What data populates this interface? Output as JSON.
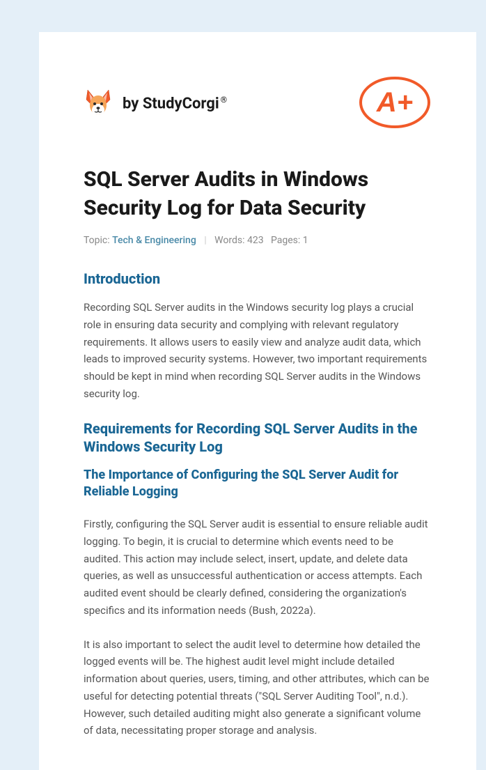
{
  "brand": {
    "prefix": "by ",
    "name": "StudyCorgi",
    "reg": "®"
  },
  "grade": "A+",
  "title": "SQL Server Audits in Windows Security Log for Data Security",
  "meta": {
    "topic_label": "Topic: ",
    "topic_value": "Tech & Engineering",
    "words_label": "Words: ",
    "words_value": "423",
    "pages_label": "Pages: ",
    "pages_value": "1"
  },
  "sections": {
    "intro_heading": "Introduction",
    "intro_p1": "Recording SQL Server audits in the Windows security log plays a crucial role in ensuring data security and complying with relevant regulatory requirements. It allows users to easily view and analyze audit data, which leads to improved security systems. However, two important requirements should be kept in mind when recording SQL Server audits in the Windows security log.",
    "req_heading": "Requirements for Recording SQL Server Audits in the Windows Security Log",
    "sub_heading": "The Importance of Configuring the SQL Server Audit for Reliable Logging",
    "para1": "Firstly, configuring the SQL Server audit is essential to ensure reliable audit logging. To begin, it is crucial to determine which events need to be audited. This action may include select, insert, update, and delete data queries, as well as unsuccessful authentication or access attempts. Each audited event should be clearly defined, considering the organization's specifics and its information needs (Bush, 2022a).",
    "para2": "It is also important to select the audit level to determine how detailed the logged events will be. The highest audit level might include detailed information about queries, users, timing, and other attributes, which can be useful for detecting potential threats (\"SQL Server Auditing Tool\", n.d.). However, such detailed auditing might also generate a significant volume of data, necessitating proper storage and analysis."
  }
}
